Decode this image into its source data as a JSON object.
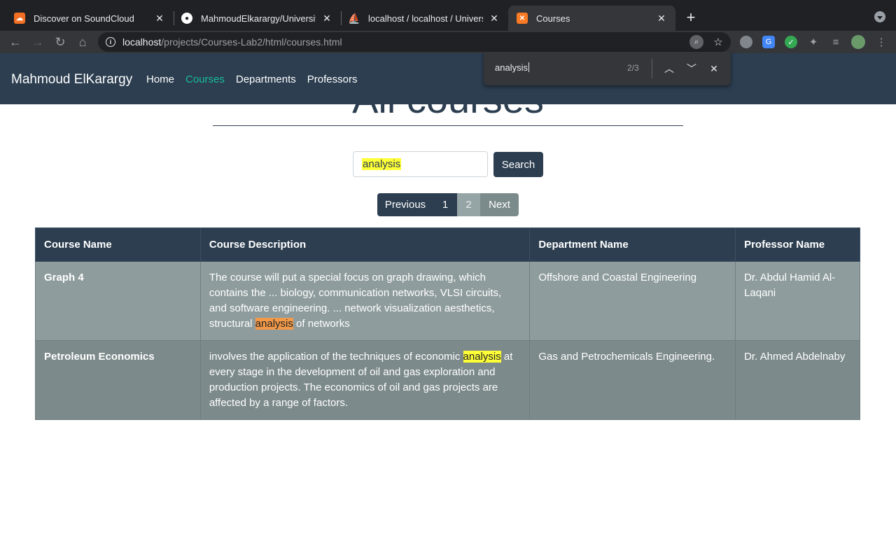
{
  "browser": {
    "tabs": [
      {
        "title": "Discover on SoundCloud",
        "icon": "soundcloud-icon"
      },
      {
        "title": "MahmoudElkarargy/University-",
        "icon": "github-icon"
      },
      {
        "title": "localhost / localhost / Universit",
        "icon": "phpmyadmin-icon"
      },
      {
        "title": "Courses",
        "icon": "xampp-icon"
      }
    ],
    "url_host": "localhost",
    "url_path": "/projects/Courses-Lab2/html/courses.html"
  },
  "find_bar": {
    "query": "analysis",
    "count": "2/3"
  },
  "navbar": {
    "brand": "Mahmoud ElKarargy",
    "links": [
      "Home",
      "Courses",
      "Departments",
      "Professors"
    ]
  },
  "page": {
    "heading": "All courses",
    "search_value": "analysis",
    "search_button": "Search",
    "pagination": {
      "prev": "Previous",
      "page1": "1",
      "page2": "2",
      "next": "Next"
    }
  },
  "table": {
    "headers": [
      "Course Name",
      "Course Description",
      "Department Name",
      "Professor Name"
    ],
    "rows": [
      {
        "name": "Graph 4",
        "desc_before": "The course will put a special focus on graph drawing, which contains the ... biology, communication networks, VLSI circuits, and software engineering. ... network visualization aesthetics, structural ",
        "desc_match": "analysis",
        "desc_after": " of networks",
        "department": "Offshore and Coastal Engineering",
        "professor": "Dr. Abdul Hamid Al-Laqani"
      },
      {
        "name": "Petroleum Economics",
        "desc_before": "involves the application of the techniques of economic ",
        "desc_match": "analysis",
        "desc_after": " at every stage in the development of oil and gas exploration and production projects. The economics of oil and gas projects are affected by a range of factors.",
        "department": "Gas and Petrochemicals Engineering.",
        "professor": "Dr. Ahmed Abdelnaby"
      }
    ]
  }
}
